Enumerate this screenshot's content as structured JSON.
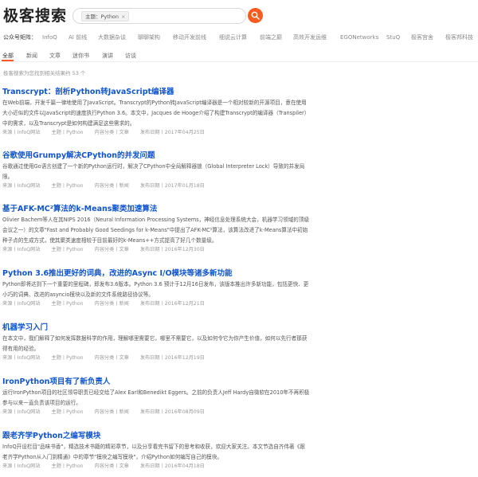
{
  "header": {
    "logo": "极客搜索",
    "tag_chip": "主题：Python",
    "tag_close": "×"
  },
  "sites": {
    "label": "公众号矩阵：",
    "items": [
      "InfoQ",
      "AI 前线",
      "大数据杂谈",
      "聊聊架构",
      "移动开发前线",
      "细说云计算",
      "前端之巅",
      "高效开发运维",
      "EGONetworks",
      "StuQ",
      "极客宫舍",
      "极客邦科技"
    ]
  },
  "tabs": [
    "全部",
    "新闻",
    "文章",
    "迷你书",
    "演讲",
    "访谈"
  ],
  "result_count": "极客搜索为您找到相关结果约 53 个",
  "results": [
    {
      "title": "Transcrypt：剖析Python转JavaScript编译器",
      "snippet": "在Web前端，开发千篇一律地使用了JavaScript。Transcrypt的Python转JavaScript编译器是一个相对较新的开源项目，意在使用大小近似的文件以JavaScript的速度执行Python 3.6。本文中，Jacques de Hooge介绍了构建Transcrypt的编译器（Transpiler）中的需求，以及Transcrypt是如何构建满足这些需求的。",
      "source": "来源丨InfoQ网站",
      "topic": "主题丨Python",
      "category": "内容分类丨文章",
      "date": "发布日期丨2017年04月25日"
    },
    {
      "title": "谷歌使用Grumpy解决CPython的并发问题",
      "snippet": "谷歌通过使用Go语言创建了一个新的Python运行时，解决了CPython中全局解释器锁（Global Interpreter Lock）导致的并发局限。",
      "source": "来源丨InfoQ网站",
      "topic": "主题丨Python",
      "category": "内容分类丨新闻",
      "date": "发布日期丨2017年01月18日"
    },
    {
      "title": "基于AFK-MC²算法的k-Means聚类加速算法",
      "snippet": "Olivier Bachem等人在其NIPS 2016（Neural Information Processing Systems，神经信息处理系统大会，机器学习领域的顶级会议之一）的文章\"Fast and Probably Good Seedings for k-Means\"中提出了AFK-MC²算法，该算法改进了k-Means算法中初始种子点的生成方式，使其聚类速度相较于目前最好的k-Means++方式提高了好几个数量级。",
      "source": "来源丨InfoQ网站",
      "topic": "主题丨Python",
      "category": "内容分类丨文章",
      "date": "发布日期丨2016年12月30日"
    },
    {
      "title": "Python 3.6推出更好的词典，改进的Async I/O模块等诸多新功能",
      "snippet": "Python即将达到下一个重要的里程碑，即发布3.6版本。Python 3.6 预计于12月16日发布，该版本推出许多新功能，包括更快、更小巧的词典、改进的asyncio模块以及新的文件系统路径协议等。",
      "source": "来源丨InfoQ网站",
      "topic": "主题丨Python",
      "category": "内容分类丨新闻",
      "date": "发布日期丨2016年12月21日"
    },
    {
      "title": "机器学习入门",
      "snippet": "在本文中，我们解释了如何发挥数据科学的作用，理解哪里需要它，哪里不需要它，以及如何令它为你产生价值，如何以先行者那获得有用的经验。",
      "source": "来源丨InfoQ网站",
      "topic": "主题丨Python",
      "category": "内容分类丨文章",
      "date": "发布日期丨2016年12月19日"
    },
    {
      "title": "IronPython项目有了新负责人",
      "snippet": "运行IronPython项目的社区领导职责已经交给了Alex Earl和Benedikt Eggers。之前的负责人Jeff Hardy自微软在2010年不再积极参与以来一直负责该项目的运行。",
      "source": "来源丨InfoQ网站",
      "topic": "主题丨Python",
      "category": "内容分类丨新闻",
      "date": "发布日期丨2016年08月09日"
    },
    {
      "title": "跟老齐学Python之编写模块",
      "snippet": "InfoQ开设栏目\"品味书香\"，精选技术书籍的精彩章节，以及分享看完书留下的思考和收获，欢迎大家关注。本文节选自齐伟著《跟老齐学Python从入门到精通》中的章节\"模块之编写模块\"，介绍Python如何编写自己的模块。",
      "source": "来源丨InfoQ网站",
      "topic": "主题丨Python",
      "category": "内容分类丨文章",
      "date": "发布日期丨2016年04月18日"
    }
  ],
  "colors": {
    "accent": "#ff5a1f",
    "link": "#1155cc"
  },
  "icons": {
    "search": "search-icon",
    "close": "close-icon"
  }
}
